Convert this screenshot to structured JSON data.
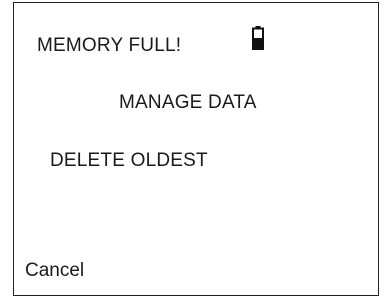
{
  "screen": {
    "message": "MEMORY FULL!",
    "battery_icon": "battery-low-icon",
    "menu": {
      "items": [
        {
          "label": "MANAGE DATA"
        },
        {
          "label": "DELETE OLDEST"
        }
      ]
    },
    "softkey_left": "Cancel"
  },
  "colors": {
    "background": "#ffffff",
    "text": "#1a1a1a",
    "border": "#222222"
  }
}
